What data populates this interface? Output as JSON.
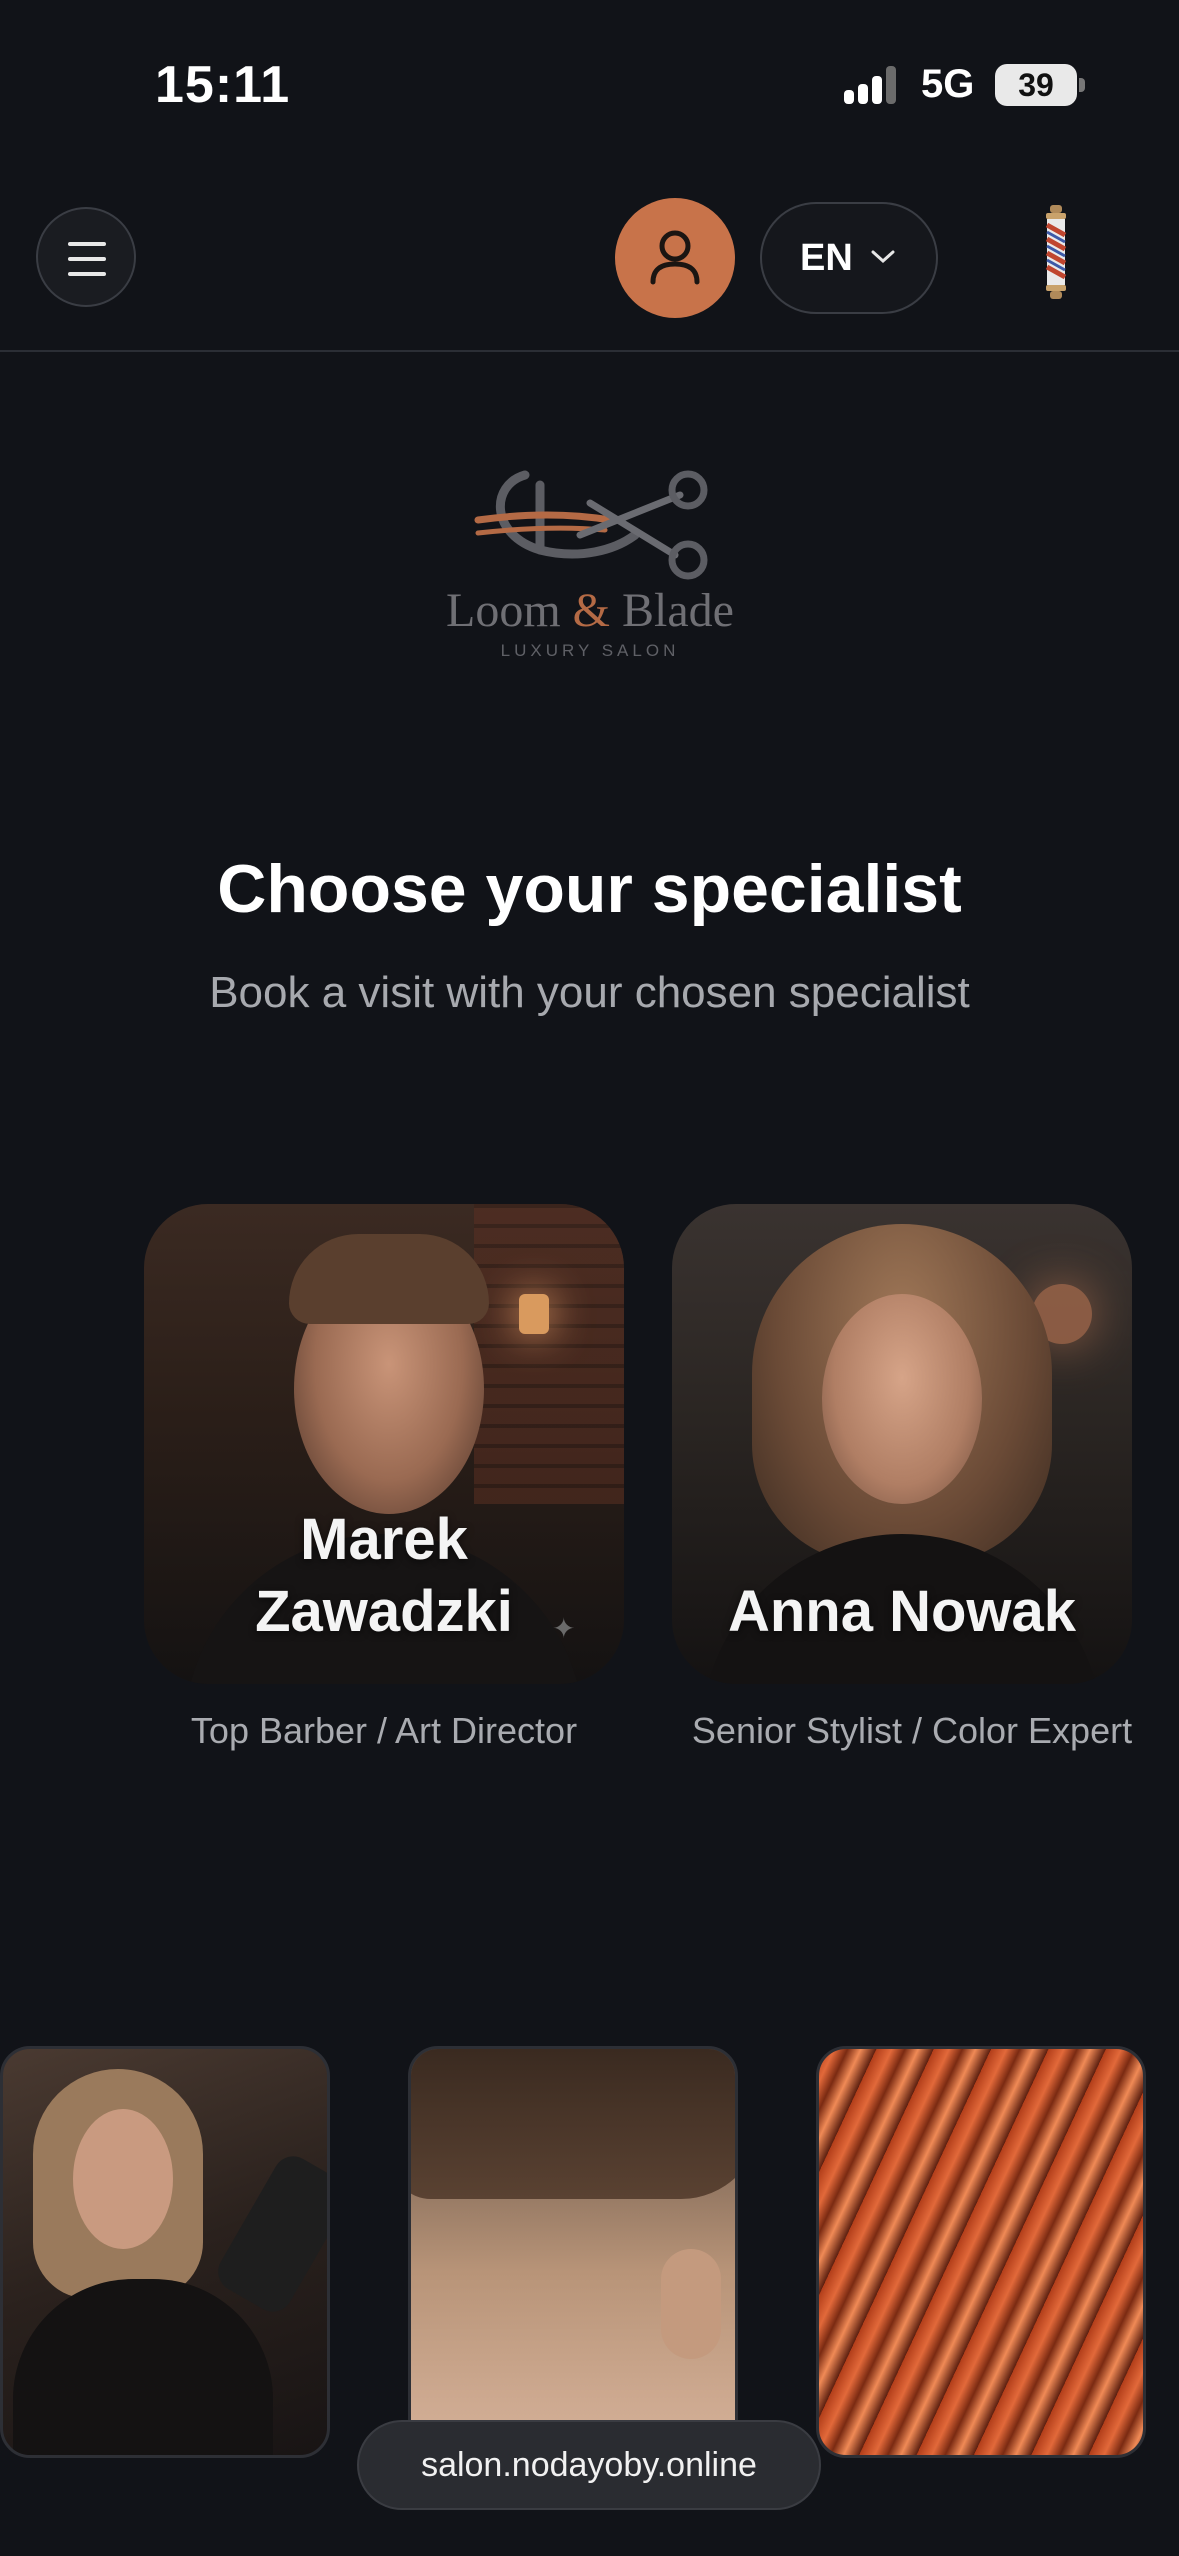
{
  "status_bar": {
    "time": "15:11",
    "network": "5G",
    "battery": "39"
  },
  "header": {
    "language": "EN",
    "menu_icon": "hamburger-icon",
    "profile_icon": "user-icon",
    "logo_icon": "barber-pole-icon"
  },
  "brand": {
    "name_left": "Loom",
    "ampersand": "&",
    "name_right": "Blade",
    "tagline": "LUXURY SALON"
  },
  "main": {
    "title": "Choose your specialist",
    "subtitle": "Book a visit with your chosen specialist",
    "specialists": [
      {
        "name_line1": "Marek",
        "name_line2": "Zawadzki",
        "role": "Top Barber / Art Director"
      },
      {
        "name_line1": "Anna Nowak",
        "name_line2": "",
        "role": "Senior Stylist / Color Expert"
      }
    ]
  },
  "browser": {
    "url": "salon.nodayoby.online"
  },
  "colors": {
    "background": "#111318",
    "accent": "#c8734a"
  }
}
